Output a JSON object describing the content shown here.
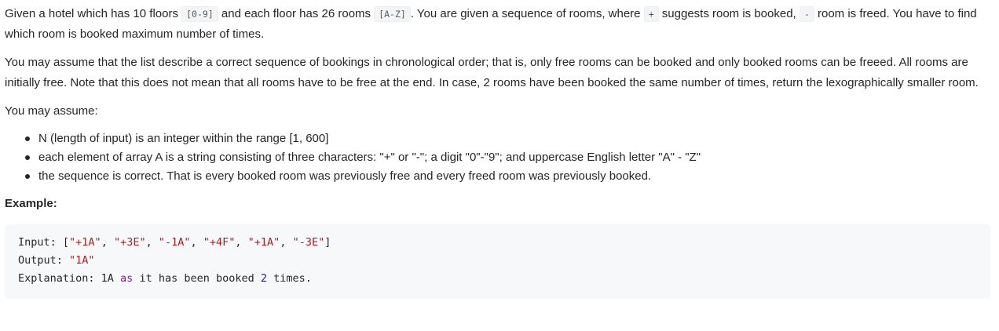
{
  "intro": {
    "t1": "Given a hotel which has 10 floors ",
    "code_floors": "[0-9]",
    "t2": " and each floor has 26 rooms ",
    "code_rooms": "[A-Z]",
    "t3": ". You are given a sequence of rooms, where ",
    "code_plus": "+",
    "t4": " suggests room is booked, ",
    "code_minus": "-",
    "t5": " room is freed. You have to find which room is booked maximum number of times."
  },
  "assumption_paragraph": "You may assume that the list describe a correct sequence of bookings in chronological order; that is, only free rooms can be booked and only booked rooms can be freeed. All rooms are initially free. Note that this does not mean that all rooms have to be free at the end. In case, 2 rooms have been booked the same number of times, return the lexographically smaller room.",
  "you_may_assume": "You may assume:",
  "bullets": [
    "N (length of input) is an integer within the range [1, 600]",
    "each element of array A is a string consisting of three characters: \"+\" or \"-\"; a digit \"0\"-\"9\"; and uppercase English letter \"A\" - \"Z\"",
    "the sequence is correct. That is every booked room was previously free and every freed room was previously booked."
  ],
  "example": {
    "heading": "Example:",
    "input_label": "Input: ",
    "input_open": "[",
    "input_items": [
      "\"+1A\"",
      "\"+3E\"",
      "\"-1A\"",
      "\"+4F\"",
      "\"+1A\"",
      "\"-3E\""
    ],
    "input_sep": ", ",
    "input_close": "]",
    "output_label": "Output: ",
    "output_value": "\"1A\"",
    "explanation_label": "Explanation: 1A ",
    "explanation_kw": "as",
    "explanation_mid": " it has been booked ",
    "explanation_num": "2",
    "explanation_end": " times."
  }
}
